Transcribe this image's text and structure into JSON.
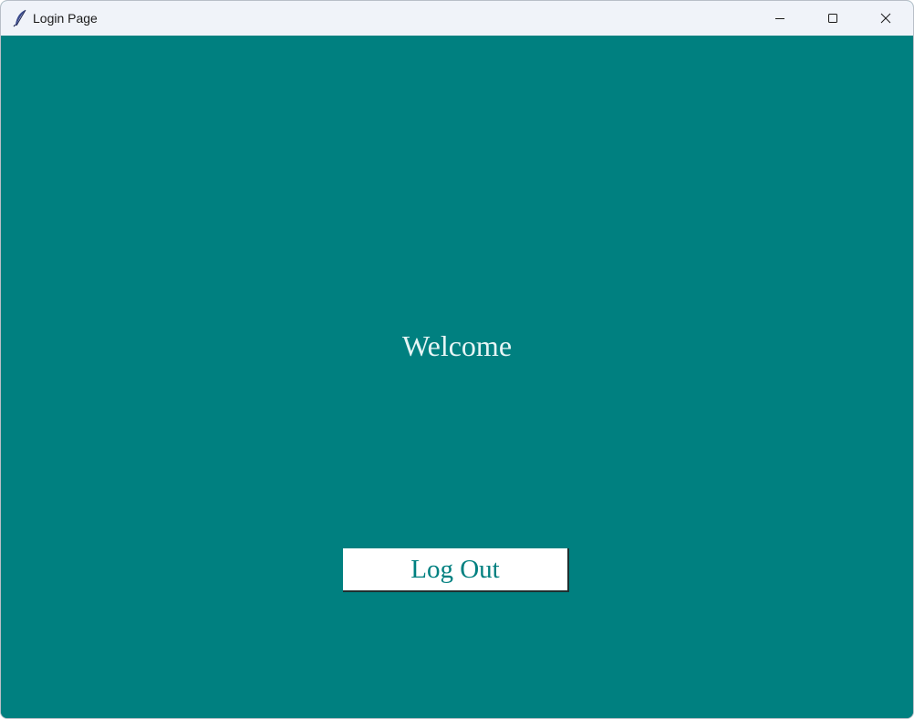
{
  "window": {
    "title": "Login Page",
    "app_icon": "feather-icon",
    "controls": {
      "minimize_icon": "minimize-icon",
      "maximize_icon": "maximize-icon",
      "close_icon": "close-icon"
    }
  },
  "main": {
    "welcome_text": "Welcome",
    "logout_label": "Log Out"
  },
  "colors": {
    "background": "#008080",
    "titlebar": "#f0f3f9",
    "welcome_text": "#e6f5f5",
    "button_bg": "#ffffff",
    "button_text": "#008080"
  }
}
